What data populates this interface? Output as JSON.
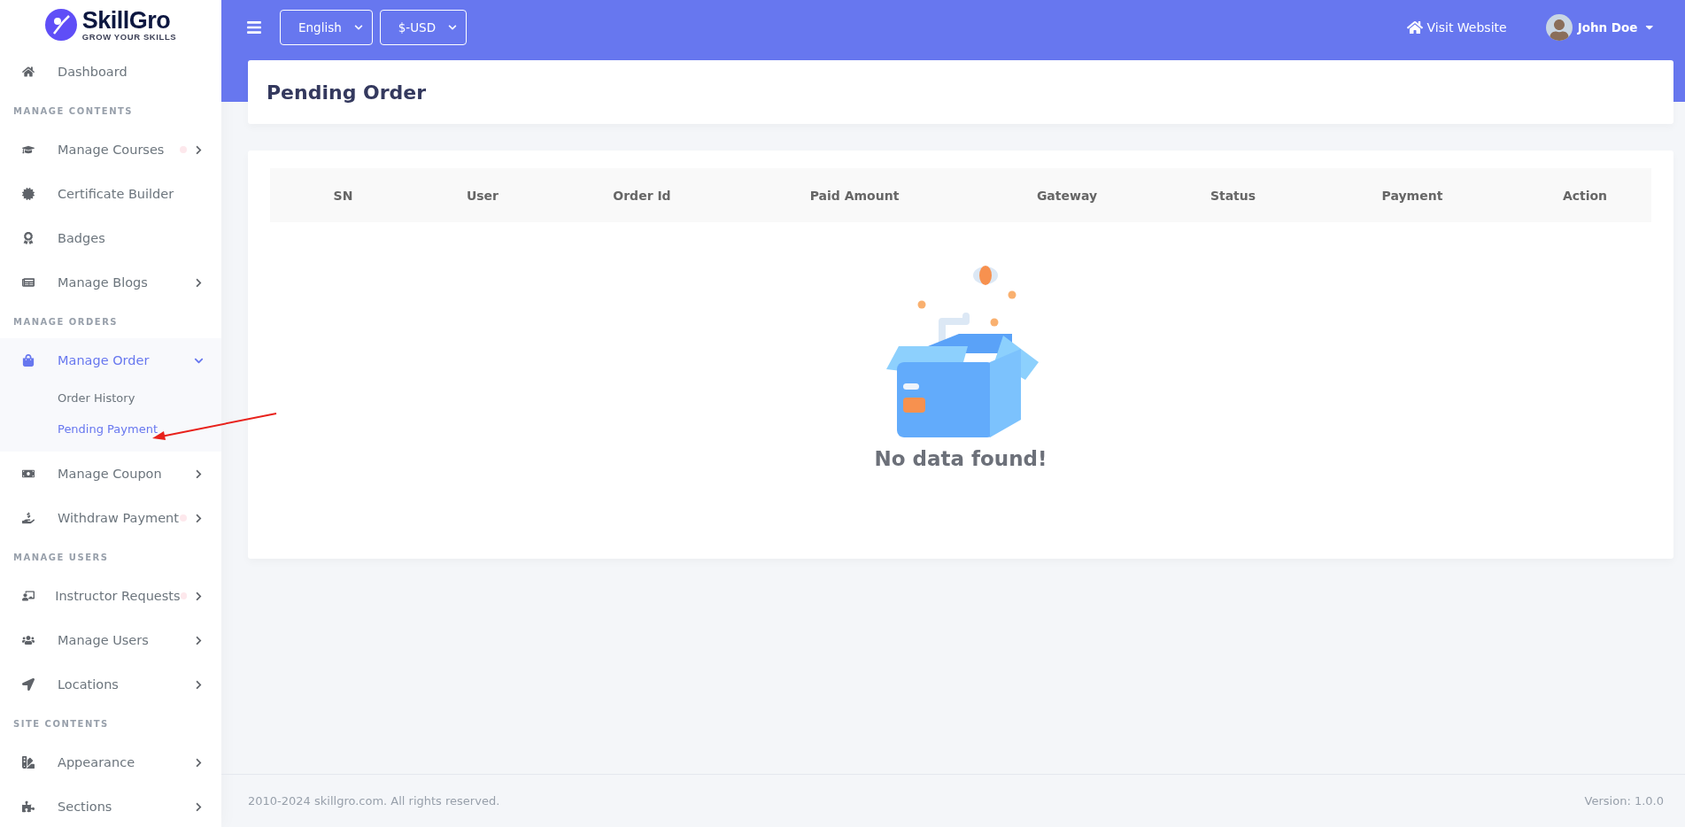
{
  "brand": {
    "name": "SkillGro",
    "tagline": "GROW YOUR SKILLS"
  },
  "sidebar": {
    "items": [
      {
        "kind": "link",
        "label": "Dashboard",
        "expandable": false,
        "dot": false,
        "selected": false
      },
      {
        "kind": "heading",
        "label": "MANAGE CONTENTS"
      },
      {
        "kind": "link",
        "label": "Manage Courses",
        "expandable": true,
        "expanded": false,
        "dot": true,
        "selected": false
      },
      {
        "kind": "link",
        "label": "Certificate Builder",
        "expandable": false,
        "dot": false,
        "selected": false
      },
      {
        "kind": "link",
        "label": "Badges",
        "expandable": false,
        "dot": false,
        "selected": false
      },
      {
        "kind": "link",
        "label": "Manage Blogs",
        "expandable": true,
        "expanded": false,
        "dot": false,
        "selected": false
      },
      {
        "kind": "heading",
        "label": "MANAGE ORDERS"
      },
      {
        "kind": "link",
        "label": "Manage Order",
        "expandable": true,
        "expanded": true,
        "dot": false,
        "selected": true,
        "children": [
          {
            "label": "Order History",
            "selected": false
          },
          {
            "label": "Pending Payment",
            "selected": true
          }
        ]
      },
      {
        "kind": "link",
        "label": "Manage Coupon",
        "expandable": true,
        "expanded": false,
        "dot": false,
        "selected": false
      },
      {
        "kind": "link",
        "label": "Withdraw Payment",
        "expandable": true,
        "expanded": false,
        "dot": true,
        "selected": false
      },
      {
        "kind": "heading",
        "label": "MANAGE USERS"
      },
      {
        "kind": "link",
        "label": "Instructor Requests",
        "expandable": true,
        "expanded": false,
        "dot": true,
        "selected": false
      },
      {
        "kind": "link",
        "label": "Manage Users",
        "expandable": true,
        "expanded": false,
        "dot": false,
        "selected": false
      },
      {
        "kind": "link",
        "label": "Locations",
        "expandable": true,
        "expanded": false,
        "dot": false,
        "selected": false
      },
      {
        "kind": "heading",
        "label": "SITE CONTENTS"
      },
      {
        "kind": "link",
        "label": "Appearance",
        "expandable": true,
        "expanded": false,
        "dot": false,
        "selected": false
      },
      {
        "kind": "link",
        "label": "Sections",
        "expandable": true,
        "expanded": false,
        "dot": false,
        "selected": false
      }
    ]
  },
  "topbar": {
    "language": "English",
    "currency": "$-USD",
    "visit_link": "Visit Website",
    "user": "John Doe"
  },
  "page_title": "Pending Order",
  "table": {
    "columns": [
      "SN",
      "User",
      "Order Id",
      "Paid Amount",
      "Gateway",
      "Status",
      "Payment",
      "Action"
    ],
    "empty_message": "No data found!"
  },
  "footer": {
    "copyright": "2010-2024 skillgro.com. All rights reserved.",
    "version": "Version: 1.0.0"
  }
}
